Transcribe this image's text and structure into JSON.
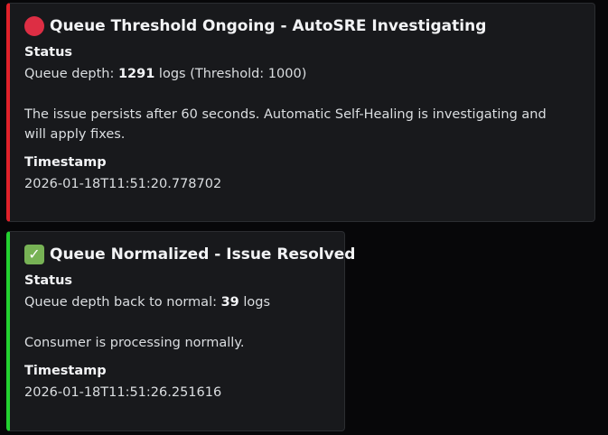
{
  "embeds": [
    {
      "title_icon": "red-circle-icon",
      "title": "Queue Threshold Ongoing - AutoSRE Investigating",
      "accent": "#e0212a",
      "status_label": "Status",
      "depth_prefix": "Queue depth: ",
      "depth_value": "1291",
      "depth_suffix": " logs (Threshold: 1000)",
      "message": "The issue persists after 60 seconds. Automatic Self-Healing is investigating and will apply fixes.",
      "timestamp_label": "Timestamp",
      "timestamp": "2026-01-18T11:51:20.778702"
    },
    {
      "title_icon": "check-mark-button-icon",
      "title_icon_glyph": "✓",
      "title": "Queue Normalized - Issue Resolved",
      "accent": "#23d130",
      "status_label": "Status",
      "depth_prefix": "Queue depth back to normal: ",
      "depth_value": "39",
      "depth_suffix": " logs",
      "message": "Consumer is processing normally.",
      "timestamp_label": "Timestamp",
      "timestamp": "2026-01-18T11:51:26.251616"
    }
  ]
}
